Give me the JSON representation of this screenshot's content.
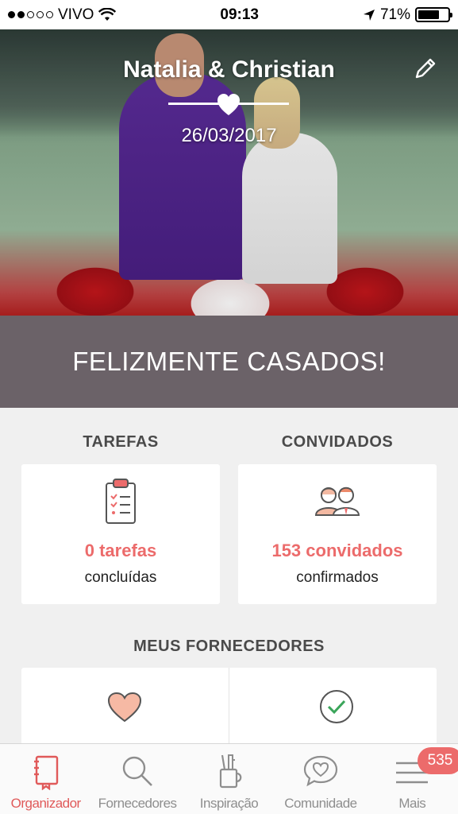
{
  "status_bar": {
    "carrier": "VIVO",
    "time": "09:13",
    "battery": "71%",
    "battery_level": 0.71,
    "signal_dots_filled": 2,
    "signal_dots_total": 5
  },
  "hero": {
    "couple_name": "Natalia & Christian",
    "date": "26/03/2017",
    "edit_icon": "pencil-icon"
  },
  "banner": {
    "text": "FELIZMENTE CASADOS!"
  },
  "tasks": {
    "title": "TAREFAS",
    "value": "0 tarefas",
    "caption": "concluídas",
    "icon": "clipboard-icon"
  },
  "guests": {
    "title": "CONVIDADOS",
    "value": "153 convidados",
    "caption": "confirmados",
    "icon": "guests-icon"
  },
  "vendors": {
    "title": "MEUS FORNECEDORES",
    "icons": [
      "heart-icon",
      "check-circle-icon"
    ]
  },
  "tab_bar": {
    "tabs": [
      {
        "label": "Organizador",
        "icon": "notebook-icon",
        "active": true
      },
      {
        "label": "Fornecedores",
        "icon": "search-icon",
        "active": false
      },
      {
        "label": "Inspiração",
        "icon": "tools-icon",
        "active": false
      },
      {
        "label": "Comunidade",
        "icon": "chat-heart-icon",
        "active": false
      },
      {
        "label": "Mais",
        "icon": "menu-icon",
        "active": false,
        "badge": "535"
      }
    ]
  },
  "colors": {
    "accent": "#ec6b6b",
    "banner": "#6b6268",
    "background": "#f0f0f0"
  }
}
